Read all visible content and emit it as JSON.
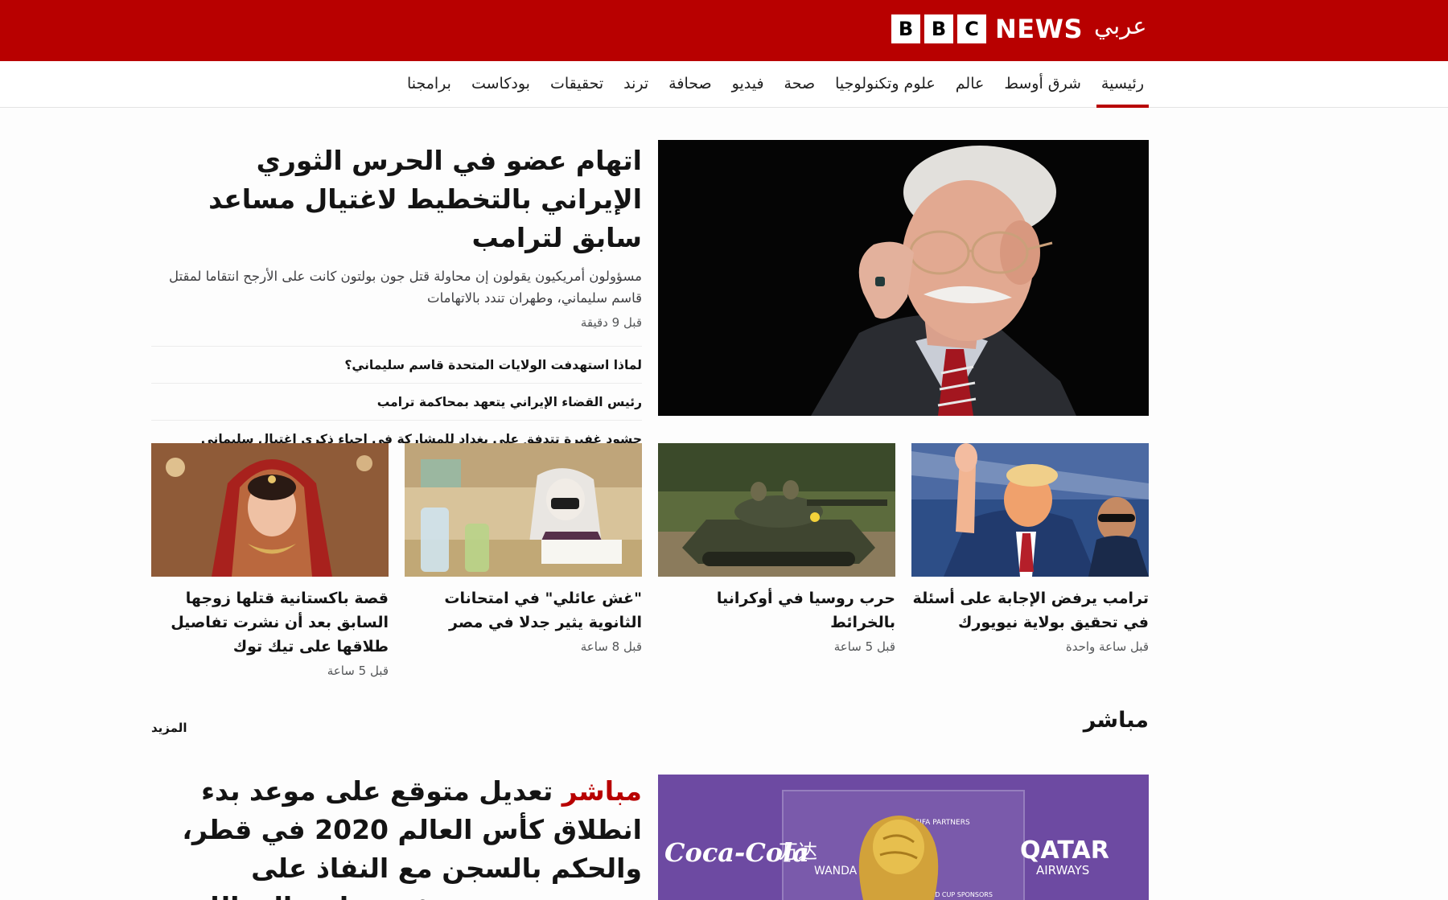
{
  "brand": {
    "b1": "B",
    "b2": "B",
    "b3": "C",
    "news": "NEWS",
    "arabic": "عربي"
  },
  "nav": {
    "items": [
      {
        "label": "رئيسية",
        "active": true
      },
      {
        "label": "شرق أوسط"
      },
      {
        "label": "عالم"
      },
      {
        "label": "علوم وتكنولوجيا"
      },
      {
        "label": "صحة"
      },
      {
        "label": "فيديو"
      },
      {
        "label": "صحافة"
      },
      {
        "label": "ترند"
      },
      {
        "label": "تحقيقات"
      },
      {
        "label": "بودكاست"
      },
      {
        "label": "برامجنا"
      }
    ]
  },
  "hero": {
    "headline": "اتهام عضو في الحرس الثوري الإيراني بالتخطيط لاغتيال مساعد سابق لترامب",
    "summary": "مسؤولون أمريكيون يقولون إن محاولة قتل جون بولتون كانت على الأرجح انتقاما لمقتل قاسم سليماني، وطهران تندد بالاتهامات",
    "time": "قبل 9 دقيقة",
    "related": [
      "لماذا استهدفت الولايات المتحدة قاسم سليماني؟",
      "رئيس القضاء الإيراني يتعهد بمحاكمة ترامب",
      "حشود غفيرة تتدفق على بغداد للمشاركة في إحياء ذكرى اغتيال سليماني والمهندس"
    ]
  },
  "cards": [
    {
      "title": "ترامب يرفض الإجابة على أسئلة في تحقيق بولاية نيويورك",
      "time": "قبل ساعة واحدة"
    },
    {
      "title": "حرب روسيا في أوكرانيا بالخرائط",
      "time": "قبل 5 ساعة"
    },
    {
      "title": "\"غش عائلي\" في امتحانات الثانوية يثير جدلا في مصر",
      "time": "قبل 8 ساعة"
    },
    {
      "title": "قصة باكستانية قتلها زوجها السابق بعد أن نشرت تفاصيل طلاقها على تيك توك",
      "time": "قبل 5 ساعة"
    }
  ],
  "live_section": {
    "title": "مباشر",
    "more": "المزيد",
    "tag": "مباشر",
    "headline": "تعديل متوقع على موعد بدء انطلاق كأس العالم 2020 في قطر، والحكم بالسجن مع النفاذ على مرتضى منصور رئيس نادي الزمالك",
    "ad_text": {
      "coke": "Coca-Cola",
      "qatar": "QATAR",
      "airways": "AIRWAYS",
      "wanda": "万达",
      "wanda_latin": "WANDA",
      "fifa": "FIFA PARTNERS",
      "cup": "WORLD CUP SPONSORS"
    }
  },
  "colors": {
    "brand_red": "#b80000",
    "text": "#141414",
    "meta": "#545658"
  }
}
